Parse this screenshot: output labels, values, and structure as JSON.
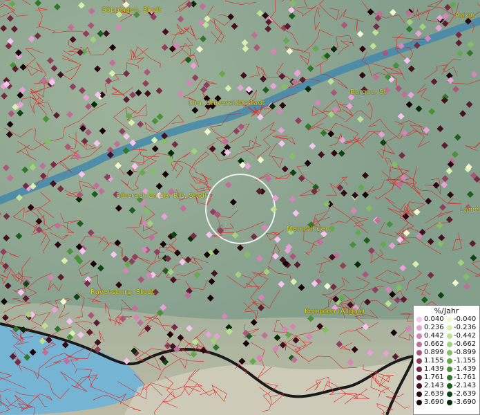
{
  "legend": {
    "title": "%/Jahr",
    "positive": [
      {
        "value": "0.040",
        "color": "#f4c6f0"
      },
      {
        "value": "0.236",
        "color": "#e6a3d6"
      },
      {
        "value": "0.442",
        "color": "#d486b6"
      },
      {
        "value": "0.662",
        "color": "#c06f98"
      },
      {
        "value": "0.899",
        "color": "#a85679"
      },
      {
        "value": "1.155",
        "color": "#8e3f5d"
      },
      {
        "value": "1.439",
        "color": "#742c45"
      },
      {
        "value": "1.761",
        "color": "#5a1c30"
      },
      {
        "value": "2.143",
        "color": "#42101f"
      },
      {
        "value": "2.639",
        "color": "#2c0712"
      },
      {
        "value": "3.690",
        "color": "#170208"
      }
    ],
    "negative": [
      {
        "value": "-0.040",
        "color": "#f2f8cf"
      },
      {
        "value": "-0.236",
        "color": "#d9efb0"
      },
      {
        "value": "-0.442",
        "color": "#bfe396"
      },
      {
        "value": "-0.662",
        "color": "#a2d27e"
      },
      {
        "value": "-0.899",
        "color": "#84be66"
      },
      {
        "value": "-1.155",
        "color": "#66a850"
      },
      {
        "value": "-1.439",
        "color": "#4a903c"
      },
      {
        "value": "-1.761",
        "color": "#31772b"
      },
      {
        "value": "-2.143",
        "color": "#1d5d1d"
      },
      {
        "value": "-2.639",
        "color": "#0e4412"
      },
      {
        "value": "-3.690",
        "color": "#052a08"
      }
    ]
  },
  "cities": [
    {
      "name": "Göppingen, Stadt"
    },
    {
      "name": "Aalen"
    },
    {
      "name": "Ulm, Universitätsstadt"
    },
    {
      "name": "Burgau, St"
    },
    {
      "name": "Biberach an der Riß, Stadt"
    },
    {
      "name": "Memmingen"
    },
    {
      "name": "Landsb"
    },
    {
      "name": "Ravensburg, Stadt"
    },
    {
      "name": "Kempten (Allgäu)"
    }
  ],
  "colors": {
    "terrain": "#8fa892",
    "river": "#3f86ad",
    "lake": "#6fb4d8",
    "borders": "#e02424",
    "label": "#d6d21a"
  }
}
